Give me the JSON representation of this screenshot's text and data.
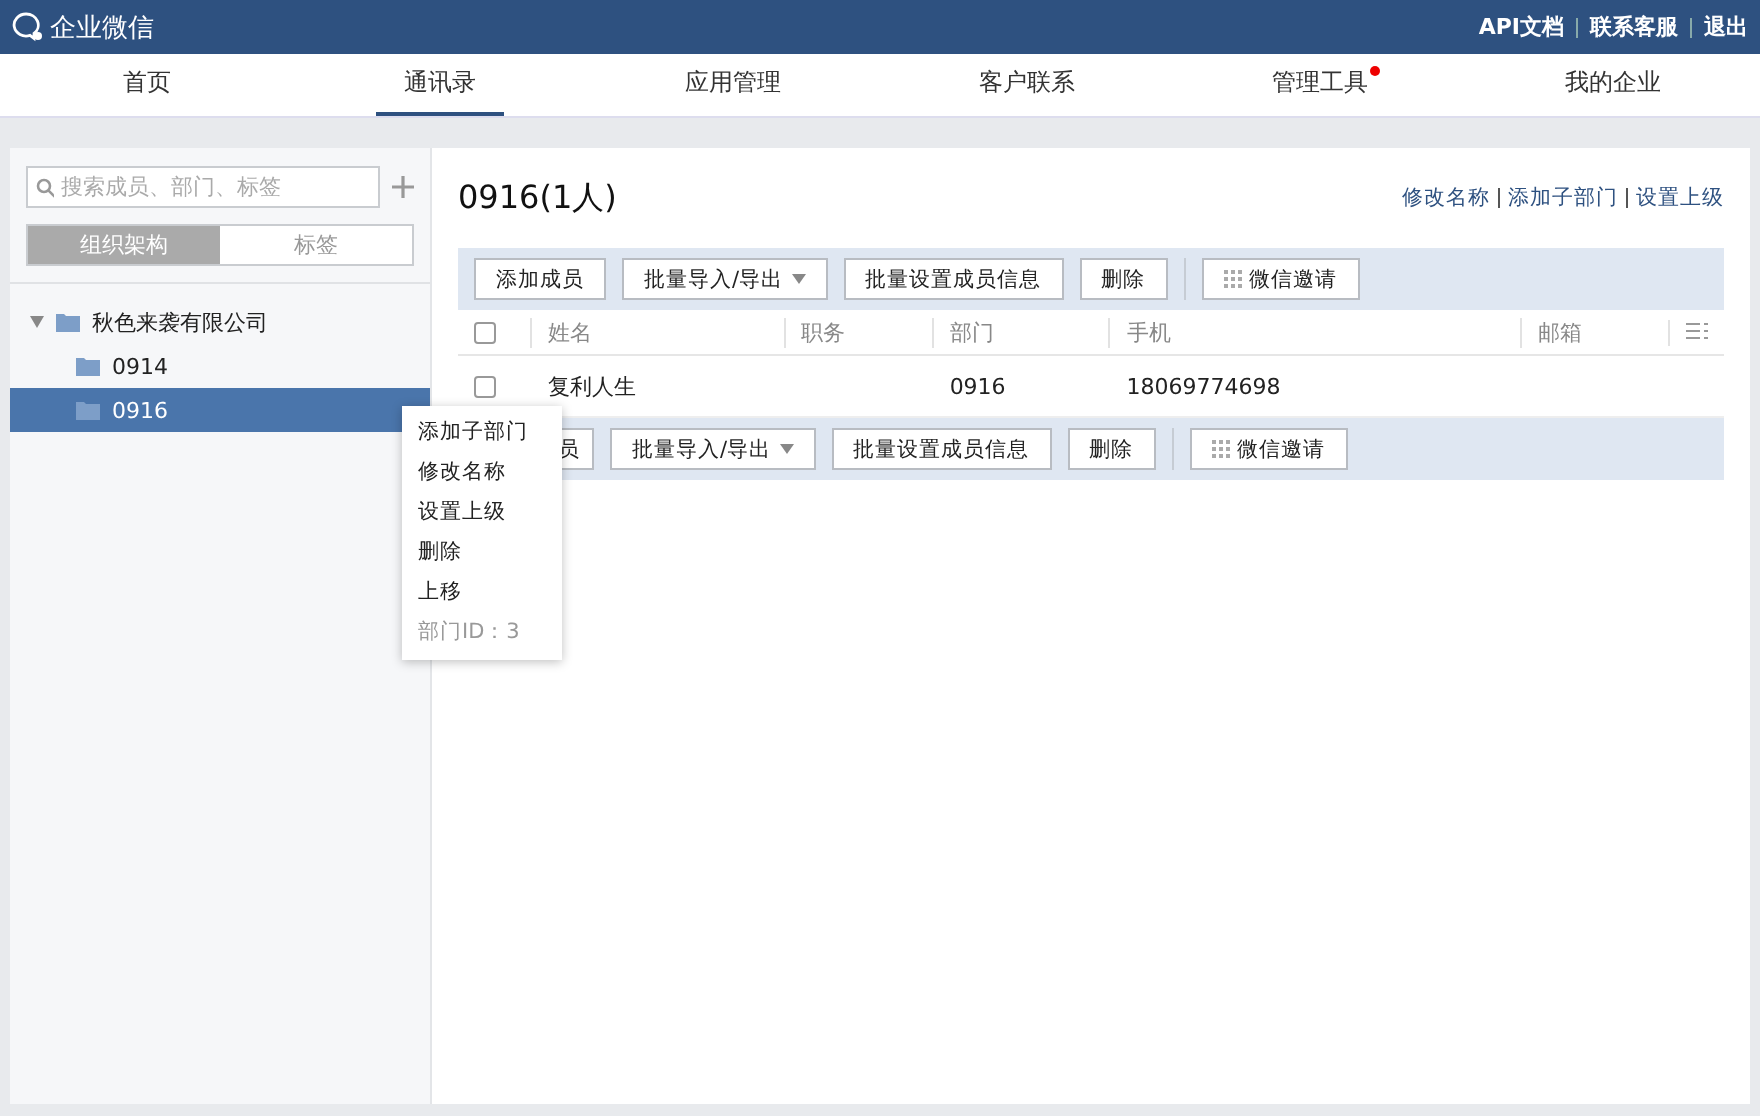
{
  "header": {
    "brand": "企业微信",
    "links": [
      "API文档",
      "联系客服",
      "退出"
    ]
  },
  "nav": [
    {
      "label": "首页",
      "selected": false,
      "dot": false
    },
    {
      "label": "通讯录",
      "selected": true,
      "dot": false
    },
    {
      "label": "应用管理",
      "selected": false,
      "dot": false
    },
    {
      "label": "客户联系",
      "selected": false,
      "dot": false
    },
    {
      "label": "管理工具",
      "selected": false,
      "dot": true
    },
    {
      "label": "我的企业",
      "selected": false,
      "dot": false
    }
  ],
  "sidebar": {
    "search": {
      "placeholder": "搜索成员、部门、标签"
    },
    "tabs": [
      {
        "label": "组织架构",
        "selected": true
      },
      {
        "label": "标签",
        "selected": false
      }
    ],
    "tree": [
      {
        "label": "秋色来袭有限公司",
        "expanded": true,
        "selected": false,
        "children": [
          {
            "label": "0914",
            "selected": false
          },
          {
            "label": "0916",
            "selected": true
          }
        ]
      }
    ]
  },
  "context_menu": {
    "items": [
      "添加子部门",
      "修改名称",
      "设置上级",
      "删除",
      "上移"
    ],
    "info": "部门ID：3"
  },
  "department": {
    "title": "0916(1人)",
    "actions": [
      "修改名称",
      "添加子部门",
      "设置上级"
    ]
  },
  "toolbar_top": [
    {
      "label": "添加成员",
      "kind": "plain"
    },
    {
      "label": "批量导入/导出",
      "kind": "dropdown"
    },
    {
      "label": "批量设置成员信息",
      "kind": "plain"
    },
    {
      "label": "删除",
      "kind": "plain"
    },
    {
      "label": "微信邀请",
      "kind": "invite"
    }
  ],
  "table": {
    "all_checked": false,
    "columns": [
      "姓名",
      "职务",
      "部门",
      "手机",
      "邮箱"
    ],
    "rows": [
      {
        "checked": false,
        "cells": [
          "复利人生",
          "",
          "0916",
          "18069774698",
          ""
        ]
      }
    ]
  },
  "toolbar_bottom": [
    {
      "label": "员",
      "kind": "covered"
    },
    {
      "label": "批量导入/导出",
      "kind": "dropdown"
    },
    {
      "label": "批量设置成员信息",
      "kind": "plain"
    },
    {
      "label": "删除",
      "kind": "plain"
    },
    {
      "label": "微信邀请",
      "kind": "invite"
    }
  ]
}
